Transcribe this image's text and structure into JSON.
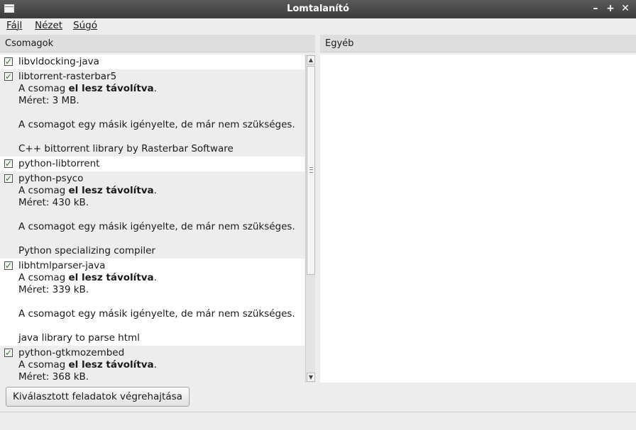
{
  "window": {
    "title": "Lomtalanító",
    "buttons": [
      "–",
      "+",
      "✕"
    ]
  },
  "menu": [
    {
      "label": "Fájl"
    },
    {
      "label": "Nézet"
    },
    {
      "label": "Súgó"
    }
  ],
  "columns": {
    "left": "Csomagok",
    "right": "Egyéb"
  },
  "common": {
    "remove_prefix": "A csomag ",
    "remove_bold": "el lesz távolítva",
    "remove_suffix": ".",
    "reason": "A csomagot egy másik igényelte, de már nem szükséges."
  },
  "packages": [
    {
      "name": "libvldocking-java",
      "checked": true,
      "expanded": false
    },
    {
      "name": "libtorrent-rasterbar5",
      "checked": true,
      "expanded": true,
      "size": "Méret: 3 MB.",
      "description": "C++ bittorrent library by Rasterbar Software"
    },
    {
      "name": "python-libtorrent",
      "checked": true,
      "expanded": false
    },
    {
      "name": "python-psyco",
      "checked": true,
      "expanded": true,
      "size": "Méret: 430 kB.",
      "description": "Python specializing compiler"
    },
    {
      "name": "libhtmlparser-java",
      "checked": true,
      "expanded": true,
      "size": "Méret: 339 kB.",
      "description": "java library to parse html"
    },
    {
      "name": "python-gtkmozembed",
      "checked": true,
      "expanded": true,
      "size": "Méret: 368 kB.",
      "description": ""
    }
  ],
  "actions": {
    "execute_label": "Kiválasztott feladatok végrehajtása"
  },
  "icons": {
    "checkbox": "checkmark-icon",
    "scroll_up": "arrow-up-icon",
    "scroll_down": "arrow-down-icon"
  }
}
